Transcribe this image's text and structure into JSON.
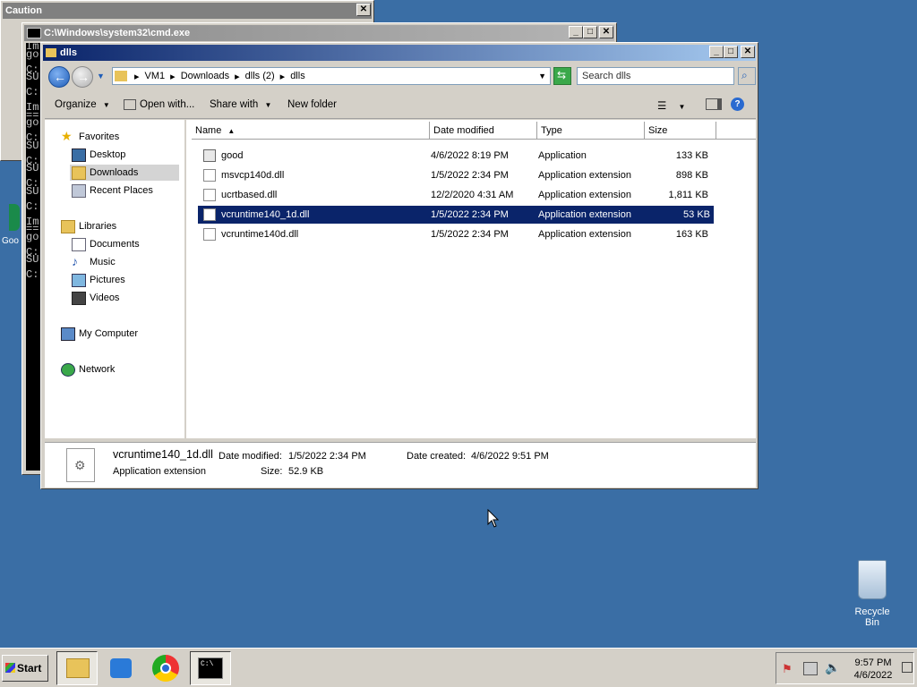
{
  "caution_window": {
    "title": "Caution"
  },
  "cmd_window": {
    "title": "C:\\Windows\\system32\\cmd.exe",
    "lines": [
      "Im",
      "go",
      "",
      "C:",
      "SU",
      "",
      "C:",
      "",
      "Im",
      "==",
      "go",
      "",
      "C:",
      "SU",
      "",
      "C:",
      "SU",
      "",
      "C:",
      "SU",
      "",
      "C:",
      "",
      "Im",
      "==",
      "go",
      "",
      "C:",
      "SU",
      "",
      "C:"
    ]
  },
  "explorer": {
    "title": "dlls",
    "breadcrumb": [
      "VM1",
      "Downloads",
      "dlls (2)",
      "dlls"
    ],
    "search_placeholder": "Search dlls",
    "commands": {
      "organize": "Organize",
      "open_with": "Open with...",
      "share_with": "Share with",
      "new_folder": "New folder"
    },
    "nav": {
      "favorites": "Favorites",
      "desktop": "Desktop",
      "downloads": "Downloads",
      "recent": "Recent Places",
      "libraries": "Libraries",
      "documents": "Documents",
      "music": "Music",
      "pictures": "Pictures",
      "videos": "Videos",
      "computer": "My Computer",
      "network": "Network"
    },
    "columns": {
      "name": "Name",
      "date": "Date modified",
      "type": "Type",
      "size": "Size"
    },
    "files": [
      {
        "name": "good",
        "date": "4/6/2022 8:19 PM",
        "type": "Application",
        "size": "133 KB"
      },
      {
        "name": "msvcp140d.dll",
        "date": "1/5/2022 2:34 PM",
        "type": "Application extension",
        "size": "898 KB"
      },
      {
        "name": "ucrtbased.dll",
        "date": "12/2/2020 4:31 AM",
        "type": "Application extension",
        "size": "1,811 KB"
      },
      {
        "name": "vcruntime140_1d.dll",
        "date": "1/5/2022 2:34 PM",
        "type": "Application extension",
        "size": "53 KB"
      },
      {
        "name": "vcruntime140d.dll",
        "date": "1/5/2022 2:34 PM",
        "type": "Application extension",
        "size": "163 KB"
      }
    ],
    "details": {
      "filename": "vcruntime140_1d.dll",
      "filetype": "Application extension",
      "date_modified_label": "Date modified:",
      "date_modified": "1/5/2022 2:34 PM",
      "size_label": "Size:",
      "size": "52.9 KB",
      "date_created_label": "Date created:",
      "date_created": "4/6/2022 9:51 PM"
    }
  },
  "desktop": {
    "recycle_bin": "Recycle Bin",
    "partial_icon": "Goo"
  },
  "taskbar": {
    "start": "Start",
    "time": "9:57 PM",
    "date": "4/6/2022"
  },
  "colors": {
    "desktop": "#3a6ea5",
    "selection": "#0a246a",
    "title_active": "#0a246a"
  }
}
